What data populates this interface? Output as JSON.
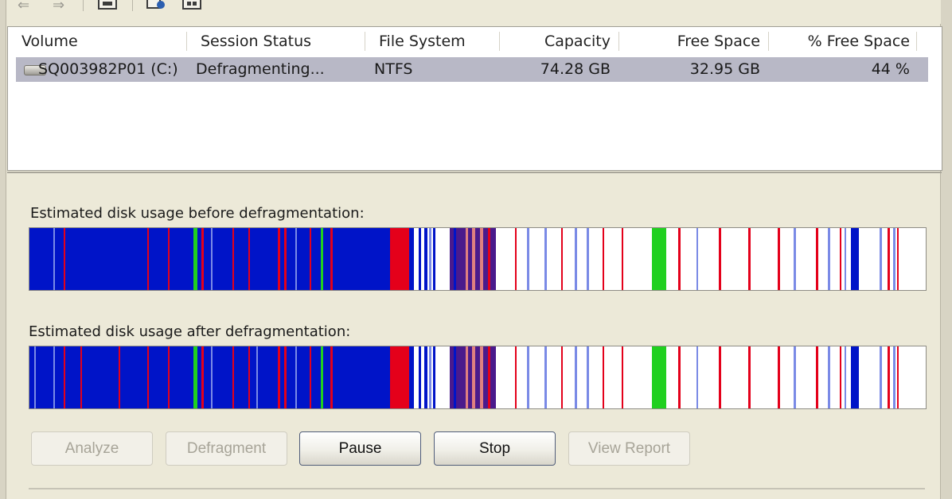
{
  "toolbar": {
    "items": [
      {
        "name": "back-arrow-icon",
        "glyph": "⇐"
      },
      {
        "name": "forward-arrow-icon",
        "glyph": "⇒"
      },
      {
        "name": "properties-icon"
      },
      {
        "name": "help-icon"
      },
      {
        "name": "console-icon"
      }
    ]
  },
  "volume_list": {
    "columns": [
      "Volume",
      "Session Status",
      "File System",
      "Capacity",
      "Free Space",
      "% Free Space"
    ],
    "rows": [
      {
        "volume": "SQ003982P01 (C:)",
        "status": "Defragmenting...",
        "file_system": "NTFS",
        "capacity": "74.28 GB",
        "free_space": "32.95 GB",
        "percent_free": "44 %",
        "icon": "hard-drive-icon"
      }
    ]
  },
  "disk_usage": {
    "before_label": "Estimated disk usage before defragmentation:",
    "after_label": "Estimated disk usage after defragmentation:",
    "colors": {
      "fragmented": "#e4001a",
      "contiguous": "#0014c8",
      "unmovable": "#20d020",
      "free": "#ffffff",
      "mixed": "#4a1a8c"
    }
  },
  "buttons": {
    "analyze": "Analyze",
    "defragment": "Defragment",
    "pause": "Pause",
    "stop": "Stop",
    "view_report": "View Report"
  }
}
